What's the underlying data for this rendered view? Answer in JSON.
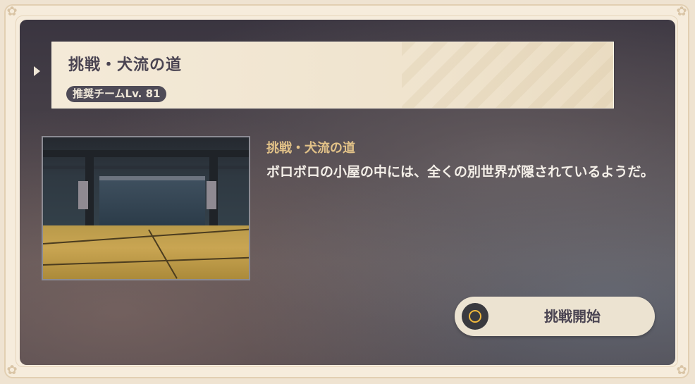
{
  "dialog": {
    "title": "挑戦・犬流の道",
    "recommended_level": "推奨チームLv. 81",
    "subtitle": "挑戦・犬流の道",
    "description": "ボロボロの小屋の中には、全くの別世界が隠されているようだ。",
    "start_button": {
      "label": "挑戦開始",
      "icon": "o-button-icon"
    },
    "thumbnail": "domain-preview-image"
  },
  "colors": {
    "accent": "#f0b83c",
    "subtitle": "#e2c288",
    "panel_dark": "#3a3540"
  }
}
